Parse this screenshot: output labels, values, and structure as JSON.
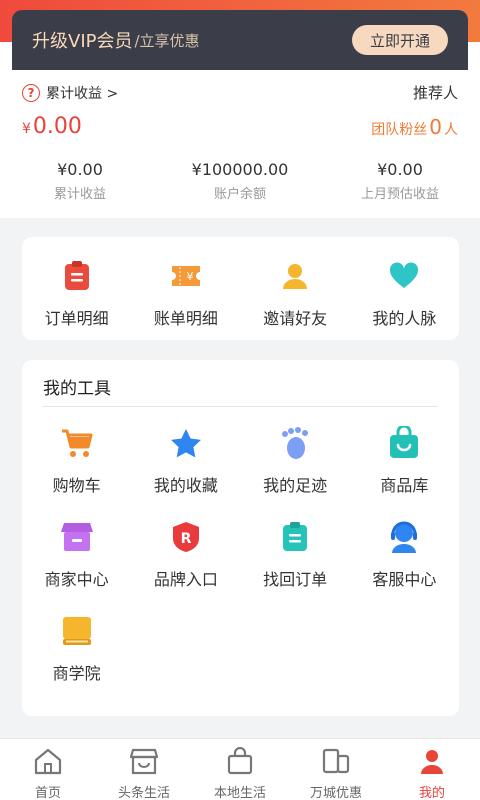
{
  "vip": {
    "title": "升级VIP会员",
    "subtitle": "/立享优惠",
    "button": "立即开通"
  },
  "earnings": {
    "help_icon": "question-icon",
    "link_label": "累计收益 >",
    "referrer_label": "推荐人",
    "amount_yen": "¥",
    "amount": "0.00",
    "fans_label": "团队粉丝",
    "fans_count": "0",
    "fans_unit": "人",
    "stats": [
      {
        "value": "¥0.00",
        "label": "累计收益"
      },
      {
        "value": "¥100000.00",
        "label": "账户余额"
      },
      {
        "value": "¥0.00",
        "label": "上月预估收益"
      }
    ]
  },
  "quick_links": [
    {
      "label": "订单明细",
      "icon": "order-clipboard-icon"
    },
    {
      "label": "账单明细",
      "icon": "bill-ticket-icon"
    },
    {
      "label": "邀请好友",
      "icon": "person-icon"
    },
    {
      "label": "我的人脉",
      "icon": "heart-icon"
    }
  ],
  "tools": {
    "title": "我的工具",
    "items": [
      {
        "label": "购物车",
        "icon": "cart-icon"
      },
      {
        "label": "我的收藏",
        "icon": "star-icon"
      },
      {
        "label": "我的足迹",
        "icon": "footprint-icon"
      },
      {
        "label": "商品库",
        "icon": "bag-icon"
      },
      {
        "label": "商家中心",
        "icon": "shop-icon"
      },
      {
        "label": "品牌入口",
        "icon": "brand-shield-icon"
      },
      {
        "label": "找回订单",
        "icon": "clipboard-icon"
      },
      {
        "label": "客服中心",
        "icon": "customer-service-icon"
      },
      {
        "label": "商学院",
        "icon": "book-icon"
      }
    ]
  },
  "nav": {
    "items": [
      {
        "label": "首页",
        "icon": "home-icon"
      },
      {
        "label": "头条生活",
        "icon": "store-icon"
      },
      {
        "label": "本地生活",
        "icon": "shopping-bag-icon"
      },
      {
        "label": "万城优惠",
        "icon": "coupon-icon"
      },
      {
        "label": "我的",
        "icon": "user-icon"
      }
    ],
    "active_index": 4
  },
  "colors": {
    "accent": "#e8443a",
    "orange": "#f07a35",
    "vip_bg": "#3b3d49",
    "vip_gold": "#f6d9bf"
  }
}
